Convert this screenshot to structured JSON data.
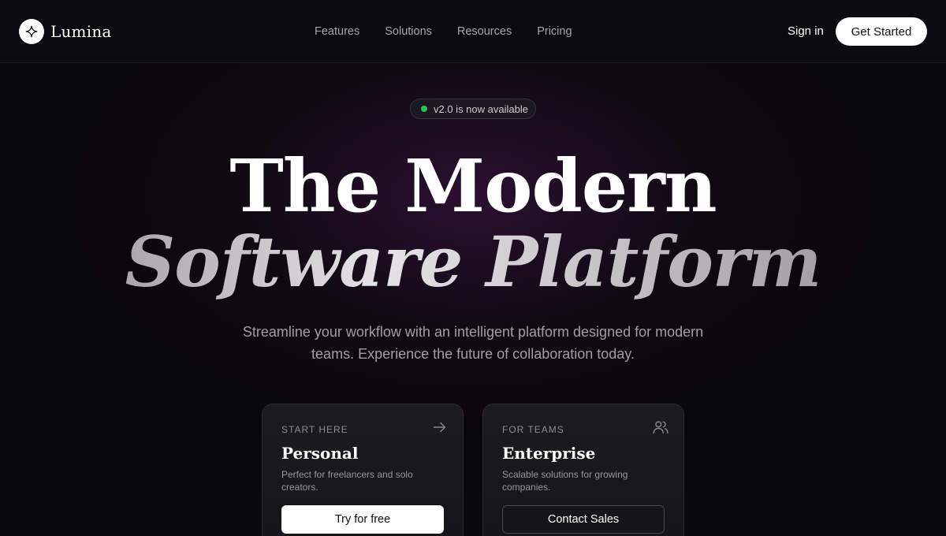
{
  "brand": {
    "name": "Lumina",
    "icon": "sparkle-icon"
  },
  "nav": {
    "links": [
      {
        "label": "Features"
      },
      {
        "label": "Solutions"
      },
      {
        "label": "Resources"
      },
      {
        "label": "Pricing"
      }
    ],
    "sign_in": "Sign in",
    "cta": "Get Started"
  },
  "badge": {
    "text": "v2.0 is now available",
    "dot_color": "#22c55e"
  },
  "hero": {
    "line1": "The Modern",
    "line2": "Software Platform",
    "subtitle": "Streamline your workflow with an intelligent platform designed for modern teams. Experience the future of collaboration today."
  },
  "cards": [
    {
      "eyebrow": "START HERE",
      "title": "Personal",
      "description": "Perfect for freelancers and solo creators.",
      "button": "Try for free",
      "icon": "arrow-right-icon"
    },
    {
      "eyebrow": "FOR TEAMS",
      "title": "Enterprise",
      "description": "Scalable solutions for growing companies.",
      "button": "Contact Sales",
      "icon": "users-icon"
    }
  ],
  "colors": {
    "background": "#09080a",
    "accent_glow": "#461650",
    "button_light": "#ffffff"
  }
}
